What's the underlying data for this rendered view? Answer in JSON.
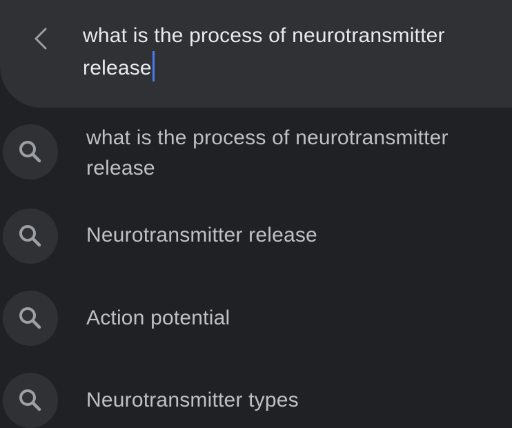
{
  "search": {
    "back_icon": "chevron-left-icon",
    "query": "what is the process of neurotransmitter release",
    "caret_color": "#4a7bf0"
  },
  "suggestions": [
    {
      "icon": "search-icon",
      "text": "what is the process of neurotransmitter release"
    },
    {
      "icon": "search-icon",
      "text": "Neurotransmitter release"
    },
    {
      "icon": "search-icon",
      "text": "Action potential"
    },
    {
      "icon": "search-icon",
      "text": "Neurotransmitter types"
    }
  ],
  "colors": {
    "background": "#202124",
    "surface": "#303134",
    "primary_text": "#e8eaed",
    "secondary_text": "#bdc1c6",
    "icon": "#9aa0a6"
  }
}
